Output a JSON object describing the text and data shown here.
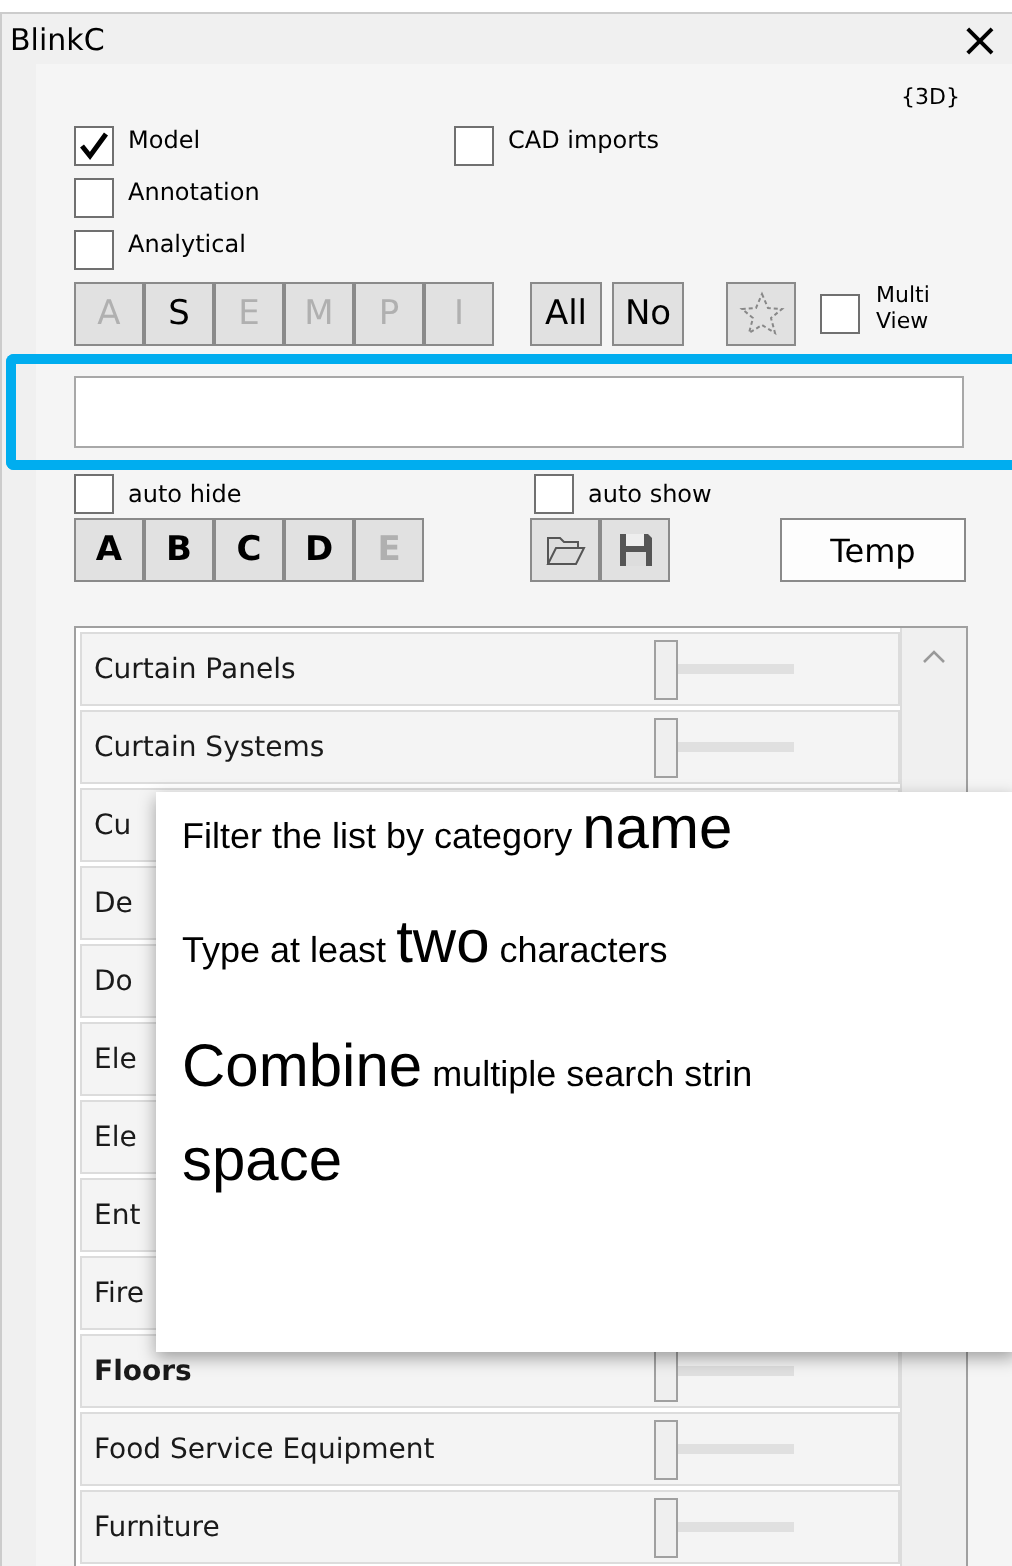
{
  "window": {
    "title": "BlinkC",
    "close": "×"
  },
  "view_label": "{3D}",
  "filters": [
    {
      "label": "Model",
      "checked": true
    },
    {
      "label": "Annotation",
      "checked": false
    },
    {
      "label": "Analytical",
      "checked": false
    },
    {
      "label": "CAD imports",
      "checked": false
    }
  ],
  "discipline_buttons": [
    {
      "label": "A",
      "disabled": true
    },
    {
      "label": "S",
      "disabled": false
    },
    {
      "label": "E",
      "disabled": true
    },
    {
      "label": "M",
      "disabled": true
    },
    {
      "label": "P",
      "disabled": true
    },
    {
      "label": "I",
      "disabled": true
    }
  ],
  "select_buttons": [
    "All",
    "No"
  ],
  "multi_view": {
    "label": "Multi View",
    "checked": false
  },
  "search": {
    "focused": true
  },
  "auto_hide": {
    "label": "auto hide",
    "checked": false
  },
  "auto_show": {
    "label": "auto show",
    "checked": false
  },
  "set_buttons": [
    {
      "label": "A",
      "disabled": false
    },
    {
      "label": "B",
      "disabled": false
    },
    {
      "label": "C",
      "disabled": false
    },
    {
      "label": "D",
      "disabled": false
    },
    {
      "label": "E",
      "disabled": true
    }
  ],
  "temp_button": "Temp",
  "categories": [
    {
      "name": "Curtain Panels",
      "bold": false,
      "level": 0
    },
    {
      "name": "Curtain Systems",
      "bold": false,
      "level": 0
    },
    {
      "name": "Cu",
      "bold": false
    },
    {
      "name": "De",
      "bold": false
    },
    {
      "name": "Do",
      "bold": false
    },
    {
      "name": "Ele",
      "bold": false
    },
    {
      "name": "Ele",
      "bold": false
    },
    {
      "name": "Ent",
      "bold": false
    },
    {
      "name": "Fire",
      "bold": false
    },
    {
      "name": "Floors",
      "bold": true,
      "level": 0
    },
    {
      "name": "Food Service Equipment",
      "bold": false,
      "level": 0
    },
    {
      "name": "Furniture",
      "bold": false,
      "level": 0
    }
  ],
  "tooltip": {
    "lines": [
      [
        {
          "text": "Filter the list by category ",
          "kind": "plain"
        },
        {
          "text": "name",
          "kind": "emphasis"
        }
      ],
      [
        {
          "text": "Type at least ",
          "kind": "plain"
        },
        {
          "text": "two",
          "kind": "emphasis"
        },
        {
          "text": " characters",
          "kind": "plain"
        }
      ],
      [
        {
          "text": "Combine",
          "kind": "emphasis"
        },
        {
          "text": " multiple search strin",
          "kind": "plain"
        }
      ],
      [
        {
          "text": "space",
          "kind": "emphasis"
        }
      ]
    ]
  }
}
